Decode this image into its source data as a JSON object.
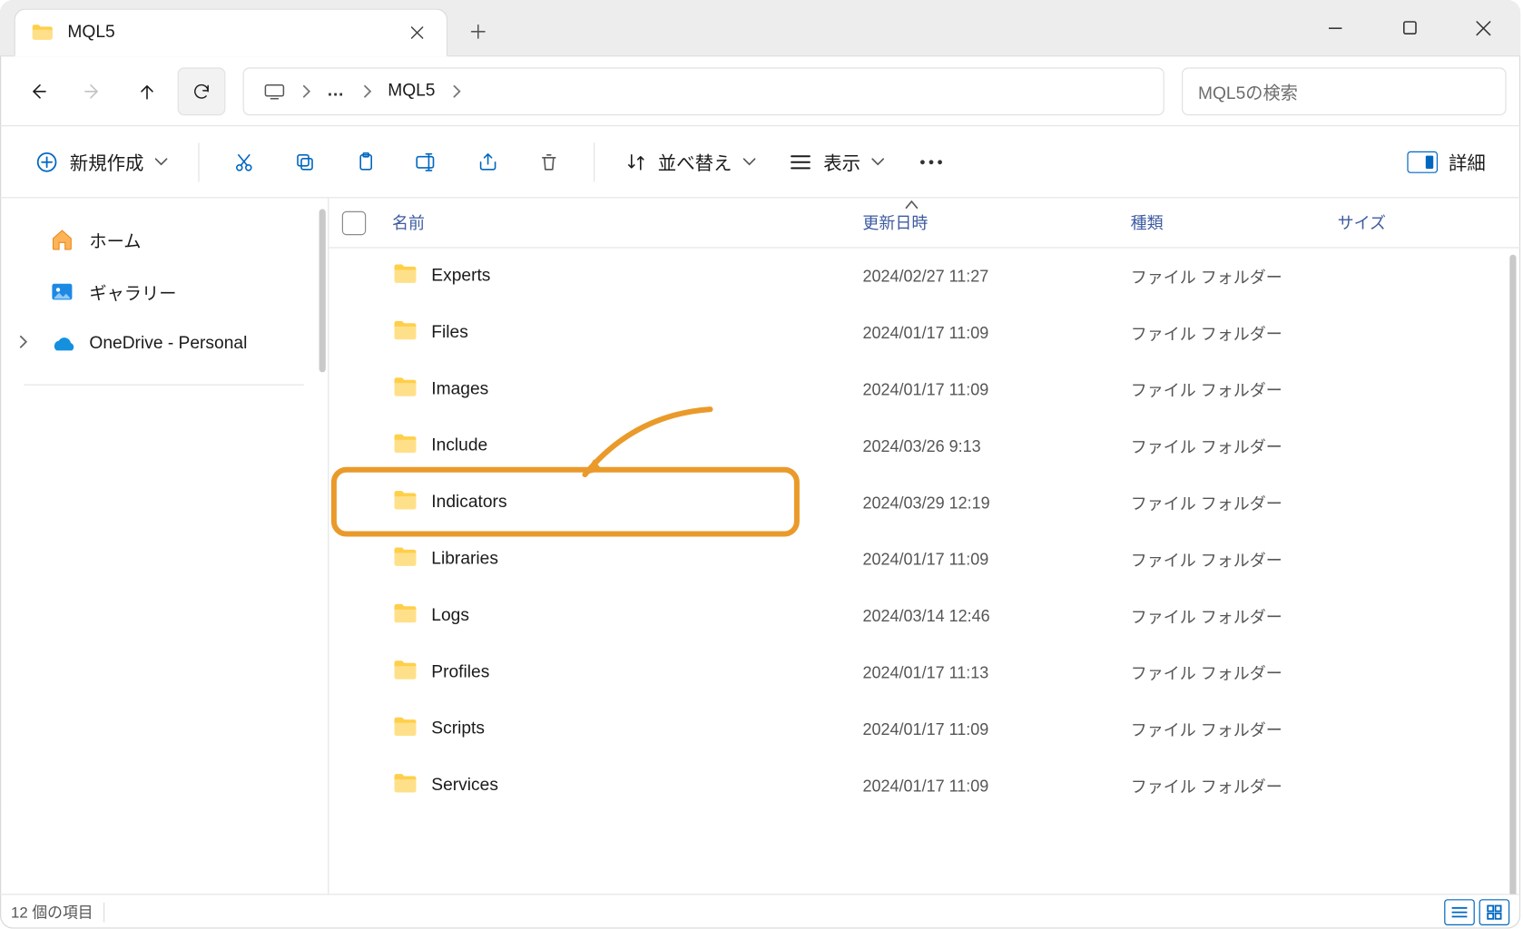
{
  "tab": {
    "title": "MQL5"
  },
  "breadcrumb": {
    "root_icon": "pc-icon",
    "ellipsis": "…",
    "current": "MQL5"
  },
  "search": {
    "placeholder": "MQL5の検索"
  },
  "toolbar": {
    "new": "新規作成",
    "sort": "並べ替え",
    "view": "表示",
    "details": "詳細"
  },
  "nav": {
    "home": "ホーム",
    "gallery": "ギャラリー",
    "onedrive": "OneDrive - Personal"
  },
  "columns": {
    "name": "名前",
    "date": "更新日時",
    "kind": "種類",
    "size": "サイズ"
  },
  "kind_folder": "ファイル フォルダー",
  "items": [
    {
      "name": "Experts",
      "date": "2024/02/27 11:27"
    },
    {
      "name": "Files",
      "date": "2024/01/17 11:09"
    },
    {
      "name": "Images",
      "date": "2024/01/17 11:09"
    },
    {
      "name": "Include",
      "date": "2024/03/26 9:13"
    },
    {
      "name": "Indicators",
      "date": "2024/03/29 12:19"
    },
    {
      "name": "Libraries",
      "date": "2024/01/17 11:09"
    },
    {
      "name": "Logs",
      "date": "2024/03/14 12:46"
    },
    {
      "name": "Profiles",
      "date": "2024/01/17 11:13"
    },
    {
      "name": "Scripts",
      "date": "2024/01/17 11:09"
    },
    {
      "name": "Services",
      "date": "2024/01/17 11:09"
    }
  ],
  "status": {
    "count": "12 個の項目"
  },
  "annotation": {
    "highlight_index": 4
  }
}
